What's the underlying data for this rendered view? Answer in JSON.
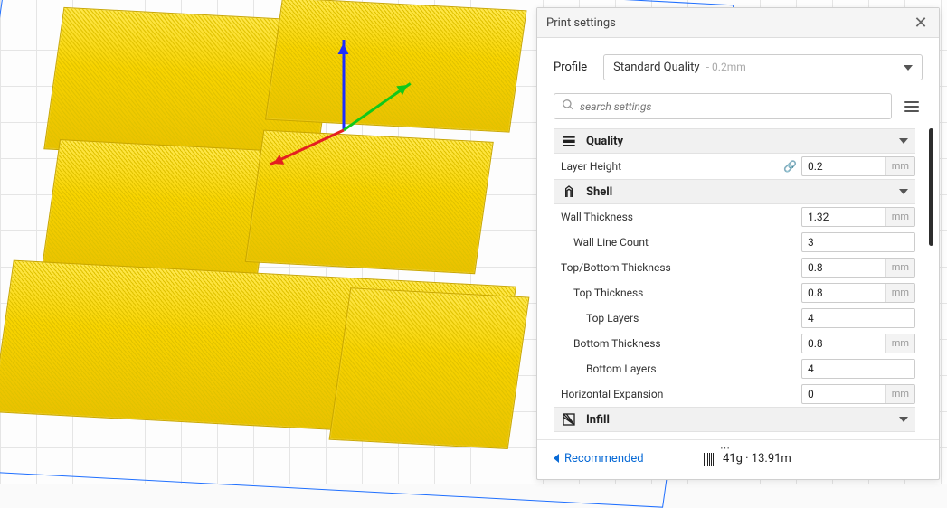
{
  "panel": {
    "title": "Print settings",
    "profile_label": "Profile",
    "profile_name": "Standard Quality",
    "profile_detail": "- 0.2mm",
    "search_placeholder": "search settings",
    "recommended_label": "Recommended"
  },
  "sections": {
    "quality": {
      "label": "Quality"
    },
    "shell": {
      "label": "Shell"
    },
    "infill": {
      "label": "Infill"
    }
  },
  "settings": {
    "layer_height": {
      "label": "Layer Height",
      "value": "0.2",
      "unit": "mm",
      "linked": true
    },
    "wall_thickness": {
      "label": "Wall Thickness",
      "value": "1.32",
      "unit": "mm"
    },
    "wall_line_count": {
      "label": "Wall Line Count",
      "value": "3"
    },
    "top_bottom_thickness": {
      "label": "Top/Bottom Thickness",
      "value": "0.8",
      "unit": "mm"
    },
    "top_thickness": {
      "label": "Top Thickness",
      "value": "0.8",
      "unit": "mm"
    },
    "top_layers": {
      "label": "Top Layers",
      "value": "4"
    },
    "bottom_thickness": {
      "label": "Bottom Thickness",
      "value": "0.8",
      "unit": "mm"
    },
    "bottom_layers": {
      "label": "Bottom Layers",
      "value": "4"
    },
    "horizontal_expansion": {
      "label": "Horizontal Expansion",
      "value": "0",
      "unit": "mm"
    }
  },
  "estimate": {
    "weight": "41g",
    "length": "13.91m"
  }
}
